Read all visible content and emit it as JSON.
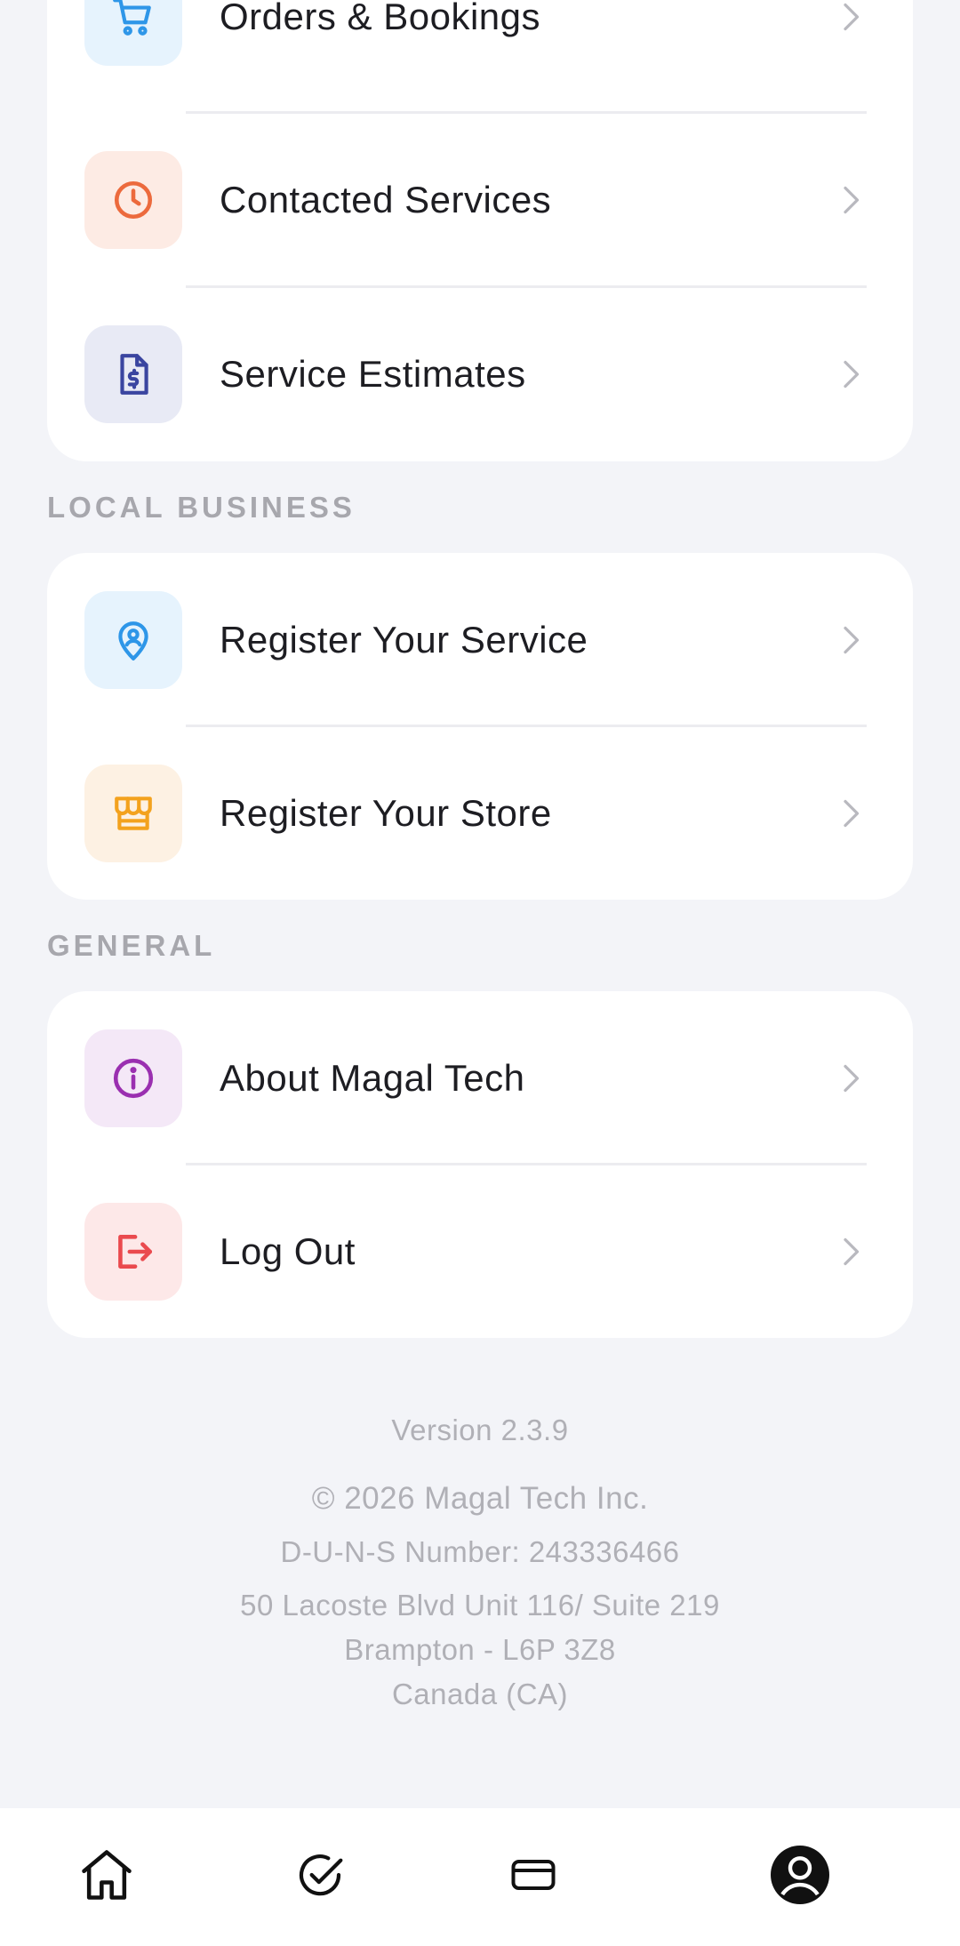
{
  "account_items": [
    {
      "label": "Orders & Bookings",
      "icon": "cart-icon",
      "icon_bg": "#e6f3fd",
      "icon_color": "#2e96e8"
    },
    {
      "label": "Contacted Services",
      "icon": "clock-icon",
      "icon_bg": "#fdebe4",
      "icon_color": "#ec6a3d"
    },
    {
      "label": "Service Estimates",
      "icon": "invoice-icon",
      "icon_bg": "#e8eaf5",
      "icon_color": "#3a45a0"
    }
  ],
  "local_business": {
    "title": "LOCAL BUSINESS",
    "items": [
      {
        "label": "Register Your Service",
        "icon": "location-person-icon",
        "icon_bg": "#e6f3fd",
        "icon_color": "#2e96e8"
      },
      {
        "label": "Register Your Store",
        "icon": "store-icon",
        "icon_bg": "#fdf1e3",
        "icon_color": "#f3a21e"
      }
    ]
  },
  "general": {
    "title": "GENERAL",
    "items": [
      {
        "label": "About Magal Tech",
        "icon": "info-icon",
        "icon_bg": "#f4e8f7",
        "icon_color": "#9a2fb0"
      },
      {
        "label": "Log Out",
        "icon": "logout-icon",
        "icon_bg": "#fde8e8",
        "icon_color": "#ea4a4e"
      }
    ]
  },
  "footer": {
    "version": "Version 2.3.9",
    "copyright": "© 2026 Magal Tech Inc.",
    "duns": "D-U-N-S Number: 243336466",
    "address_line1": "50 Lacoste Blvd Unit 116/ Suite 219",
    "address_line2": "Brampton - L6P 3Z8",
    "address_line3": "Canada (CA)"
  },
  "tabbar": {
    "tabs": [
      {
        "icon": "home-icon"
      },
      {
        "icon": "check-circle-icon"
      },
      {
        "icon": "card-icon"
      },
      {
        "icon": "profile-icon",
        "active": true
      }
    ]
  }
}
